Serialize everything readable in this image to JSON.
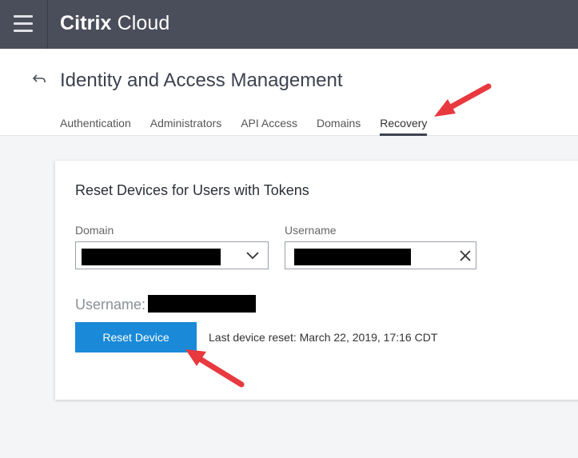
{
  "app": {
    "brand_bold": "Citrix",
    "brand_light": "Cloud"
  },
  "header": {
    "title": "Identity and Access Management",
    "tabs": [
      {
        "label": "Authentication",
        "active": false
      },
      {
        "label": "Administrators",
        "active": false
      },
      {
        "label": "API Access",
        "active": false
      },
      {
        "label": "Domains",
        "active": false
      },
      {
        "label": "Recovery",
        "active": true
      }
    ]
  },
  "card": {
    "title": "Reset Devices for Users with Tokens",
    "domain_label": "Domain",
    "username_label": "Username",
    "username_display_label": "Username:",
    "reset_button_label": "Reset Device",
    "last_reset_text": "Last device reset: March 22, 2019, 17:16 CDT"
  },
  "icons": {
    "menu": "hamburger-icon",
    "back": "back-arrow-icon",
    "dropdown": "chevron-down-icon",
    "clear": "close-icon"
  },
  "colors": {
    "topbar": "#4a4e5a",
    "primary_button": "#1a8ad8",
    "annotation_arrow": "#e8393f",
    "redaction": "#000000"
  }
}
